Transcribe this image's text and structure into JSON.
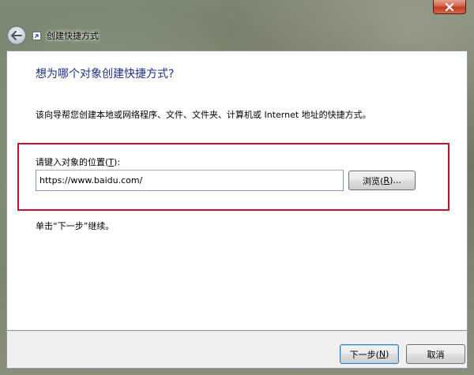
{
  "window": {
    "title": "创建快捷方式",
    "close_icon": "close-icon",
    "back_icon": "back-arrow-icon",
    "title_icon": "shortcut-icon"
  },
  "main": {
    "heading": "想为哪个对象创建快捷方式?",
    "description": "该向导帮您创建本地或网络程序、文件、文件夹、计算机或 Internet 地址的快捷方式。",
    "location_label_prefix": "请键入对象的位置(",
    "location_label_key": "T",
    "location_label_suffix": "):",
    "location_value": "https://www.baidu.com/",
    "browse_prefix": "浏览(",
    "browse_key": "R",
    "browse_suffix": ")...",
    "continue_text": "单击“下一步”继续。"
  },
  "footer": {
    "next_prefix": "下一步(",
    "next_key": "N",
    "next_suffix": ")",
    "cancel_label": "取消"
  },
  "colors": {
    "heading": "#1e3287",
    "highlight_border": "#c8102e",
    "close_button": "#c2381f"
  }
}
